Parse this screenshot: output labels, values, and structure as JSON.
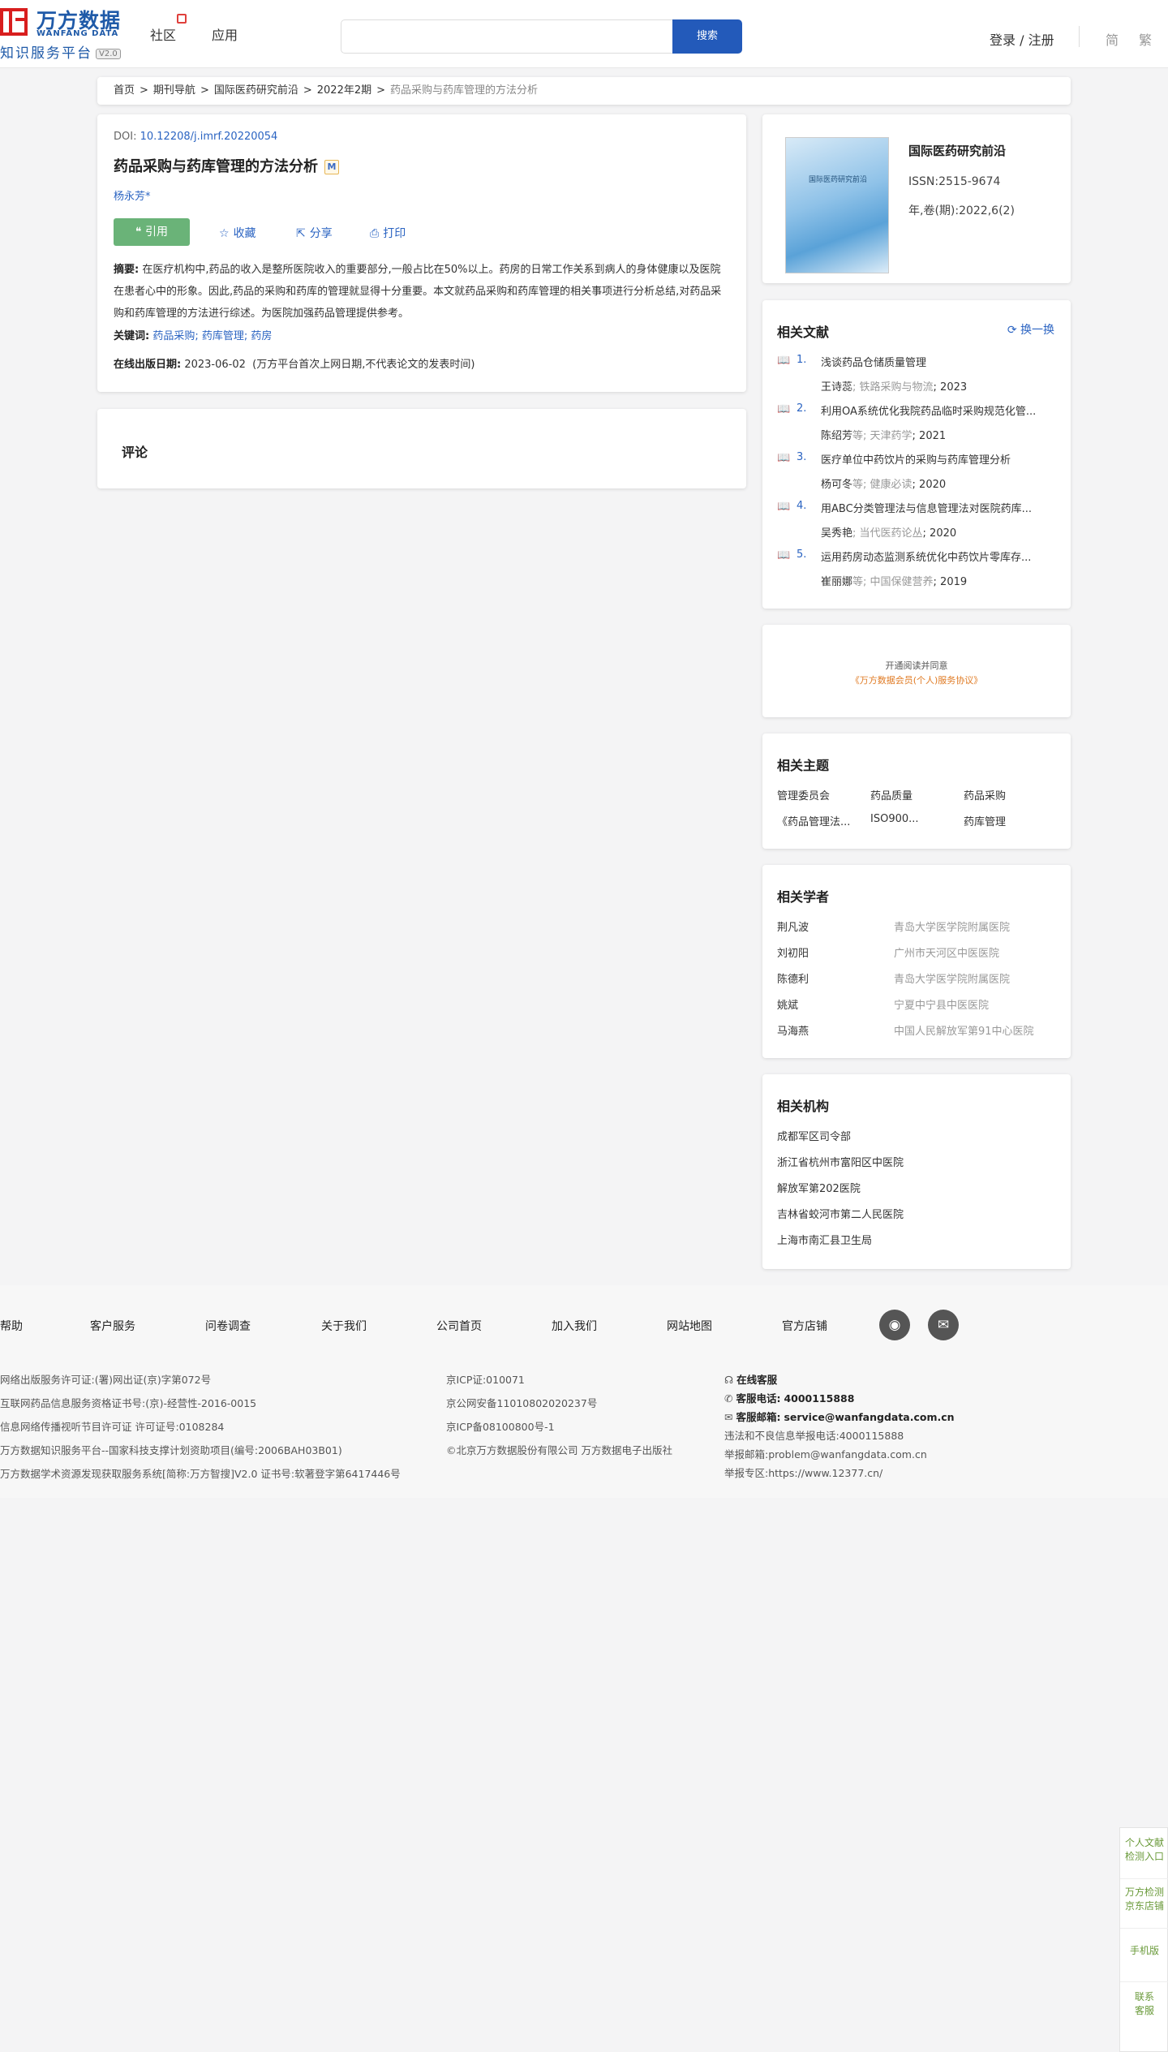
{
  "header": {
    "logo_cn": "万方数据",
    "logo_en": "WANFANG DATA",
    "logo_sub": "知识服务平台",
    "logo_version": "V2.0",
    "nav": [
      "社区",
      "应用"
    ],
    "search_placeholder": "",
    "search_button": "搜索",
    "login": "登录 / 注册",
    "lang_simplified": "简",
    "lang_traditional": "繁"
  },
  "breadcrumb": [
    "首页",
    "期刊导航",
    "国际医药研究前沿",
    "2022年2期",
    "药品采购与药库管理的方法分析"
  ],
  "breadcrumb_sep": ">",
  "article": {
    "doi_label": "DOI:",
    "doi": "10.12208/j.imrf.20220054",
    "title": "药品采购与药库管理的方法分析",
    "m_badge": "M",
    "author": "杨永芳*",
    "actions": {
      "cite": "引用",
      "favorite": "收藏",
      "share": "分享",
      "print": "打印"
    },
    "abstract_label": "摘要:",
    "abstract": "在医疗机构中,药品的收入是整所医院收入的重要部分,一般占比在50%以上。药房的日常工作关系到病人的身体健康以及医院在患者心中的形象。因此,药品的采购和药库的管理就显得十分重要。本文就药品采购和药库管理的相关事项进行分析总结,对药品采购和药库管理的方法进行综述。为医院加强药品管理提供参考。",
    "keywords_label": "关键词:",
    "keywords": "药品采购; 药库管理; 药房",
    "pubdate_label": "在线出版日期:",
    "pubdate": "2023-06-02",
    "pubdate_note": "(万方平台首次上网日期,不代表论文的发表时间)"
  },
  "comment": {
    "title": "评论"
  },
  "journal": {
    "cover_text": "国际医药研究前沿",
    "name": "国际医药研究前沿",
    "issn": "ISSN:2515-9674",
    "volume": "年,卷(期):2022,6(2)"
  },
  "related": {
    "title": "相关文献",
    "swap": "换一换",
    "items": [
      {
        "num": "1.",
        "title": "浅谈药品仓储质量管理",
        "authors": "王诗蕊",
        "source": "; 铁路采购与物流",
        "year": "; 2023"
      },
      {
        "num": "2.",
        "title": "利用OA系统优化我院药品临时采购规范化管...",
        "authors": "陈绍芳",
        "source": "等; 天津药学",
        "year": "; 2021"
      },
      {
        "num": "3.",
        "title": "医疗单位中药饮片的采购与药库管理分析",
        "authors": "杨可冬",
        "source": "等; 健康必读",
        "year": "; 2020"
      },
      {
        "num": "4.",
        "title": "用ABC分类管理法与信息管理法对医院药库...",
        "authors": "吴秀艳",
        "source": "; 当代医药论丛",
        "year": "; 2020"
      },
      {
        "num": "5.",
        "title": "运用药房动态监测系统优化中药饮片零库存...",
        "authors": "崔丽娜",
        "source": "等; 中国保健营养",
        "year": "; 2019"
      }
    ]
  },
  "agreement": {
    "line1": "开通阅读并同意",
    "line2": "《万方数据会员(个人)服务协议》"
  },
  "topics": {
    "title": "相关主题",
    "items": [
      "管理委员会",
      "药品质量",
      "药品采购",
      "《药品管理法...",
      "ISO900...",
      "药库管理"
    ]
  },
  "scholars": {
    "title": "相关学者",
    "items": [
      {
        "name": "荆凡波",
        "org": "青岛大学医学院附属医院"
      },
      {
        "name": "刘初阳",
        "org": "广州市天河区中医医院"
      },
      {
        "name": "陈德利",
        "org": "青岛大学医学院附属医院"
      },
      {
        "name": "姚斌",
        "org": "宁夏中宁县中医医院"
      },
      {
        "name": "马海燕",
        "org": "中国人民解放军第91中心医院"
      }
    ]
  },
  "orgs": {
    "title": "相关机构",
    "items": [
      "成都军区司令部",
      "浙江省杭州市富阳区中医院",
      "解放军第202医院",
      "吉林省蛟河市第二人民医院",
      "上海市南汇县卫生局"
    ]
  },
  "footer": {
    "nav": [
      "帮助",
      "客户服务",
      "问卷调查",
      "关于我们",
      "公司首页",
      "加入我们",
      "网站地图",
      "官方店铺"
    ],
    "col1": [
      "网络出版服务许可证:(署)网出证(京)字第072号",
      "互联网药品信息服务资格证书号:(京)-经营性-2016-0015",
      "信息网络传播视听节目许可证 许可证号:0108284",
      "万方数据知识服务平台--国家科技支撑计划资助项目(编号:2006BAH03B01)",
      "万方数据学术资源发现获取服务系统[简称:万方智搜]V2.0 证书号:软著登字第6417446号"
    ],
    "col2": [
      "京ICP证:010071",
      "京公网安备11010802020237号",
      "京ICP备08100800号-1",
      "©北京万方数据股份有限公司 万方数据电子出版社"
    ],
    "online_service": "在线客服",
    "phone_label": "客服电话:",
    "phone": "4000115888",
    "email_label": "客服邮箱:",
    "email": "service@wanfangdata.com.cn",
    "report_phone": "违法和不良信息举报电话:4000115888",
    "report_email": "举报邮箱:problem@wanfangdata.com.cn",
    "report_zone": "举报专区:https://www.12377.cn/"
  },
  "side_float": [
    "个人文献检测入口",
    "万方检测京东店铺",
    "手机版",
    "联系客服"
  ],
  "colors": {
    "brand_blue": "#235aba",
    "link_blue": "#2b64c2",
    "cite_green": "#6ab378",
    "agree_orange": "#e07b24",
    "logo_red": "#d81e1e"
  }
}
